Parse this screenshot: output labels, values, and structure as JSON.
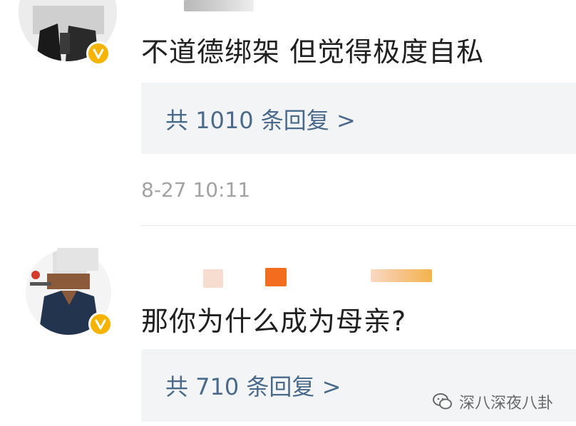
{
  "comments": [
    {
      "text": "不道德绑架 但觉得极度自私",
      "replies_label": "共 1010 条回复 >",
      "timestamp": "8-27 10:11"
    },
    {
      "text": "那你为什么成为母亲?",
      "replies_label": "共 710 条回复 >"
    }
  ],
  "colors": {
    "verified_badge": "#f6b400",
    "reply_link": "#4a6a8c",
    "reply_box_bg": "#f3f4f6",
    "timestamp": "#a2a2a2"
  },
  "icons": [
    "verified-badge-icon",
    "wechat-watermark-icon"
  ],
  "watermark": {
    "text": "深八深夜八卦"
  }
}
